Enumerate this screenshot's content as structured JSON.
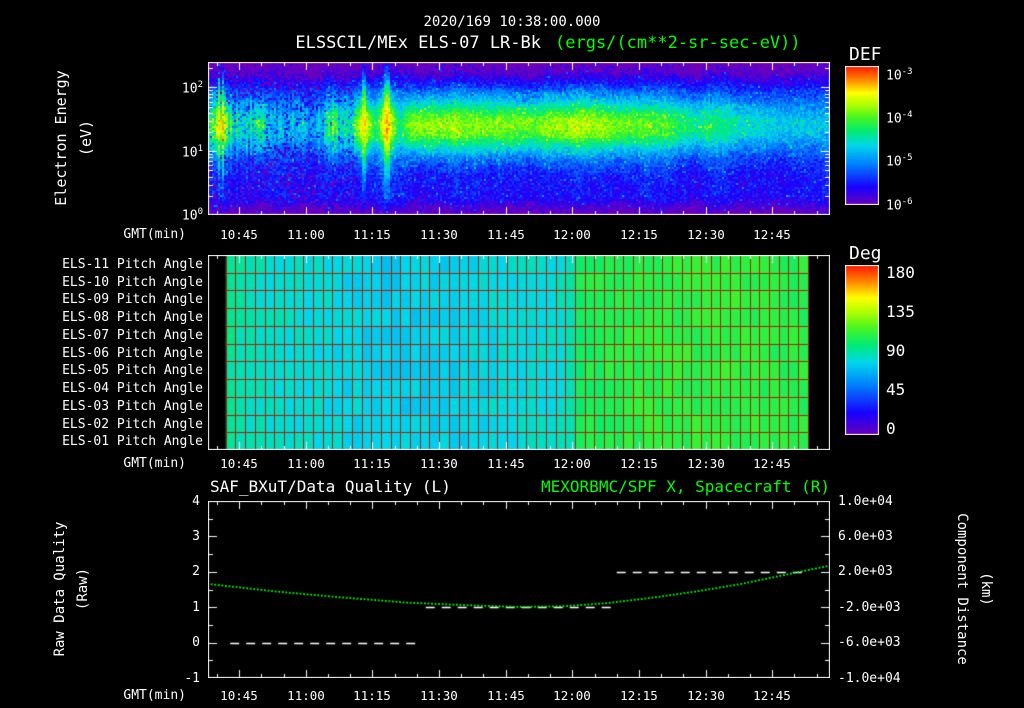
{
  "header": {
    "timestamp": "2020/169 10:38:00.000",
    "title": "ELSSCIL/MEx ELS-07 LR-Bk",
    "units": "(ergs/(cm**2-sr-sec-eV))"
  },
  "colors": {
    "background": "#000000",
    "foreground": "#ffffff",
    "accent": "#00ff00",
    "grid_red": "#aa2200"
  },
  "time_axis": {
    "label": "GMT(min)",
    "start_gmt": "10:38",
    "span_min": 140,
    "ticks": [
      "10:45",
      "11:00",
      "11:15",
      "11:30",
      "11:45",
      "12:00",
      "12:15",
      "12:30",
      "12:45"
    ]
  },
  "spectrogram": {
    "ylabel_1": "Electron Energy",
    "ylabel_2": "(eV)",
    "yticks": [
      {
        "base": "10",
        "exp": "2"
      },
      {
        "base": "10",
        "exp": "1"
      },
      {
        "base": "10",
        "exp": "0"
      }
    ],
    "colorbar": {
      "label": "DEF",
      "ticks": [
        {
          "base": "10",
          "exp": "-3"
        },
        {
          "base": "10",
          "exp": "-4"
        },
        {
          "base": "10",
          "exp": "-5"
        },
        {
          "base": "10",
          "exp": "-6"
        }
      ]
    }
  },
  "pitch_panel": {
    "rows": [
      "ELS-11 Pitch Angle",
      "ELS-10 Pitch Angle",
      "ELS-09 Pitch Angle",
      "ELS-08 Pitch Angle",
      "ELS-07 Pitch Angle",
      "ELS-06 Pitch Angle",
      "ELS-05 Pitch Angle",
      "ELS-04 Pitch Angle",
      "ELS-03 Pitch Angle",
      "ELS-02 Pitch Angle",
      "ELS-01 Pitch Angle"
    ],
    "colorbar": {
      "label": "Deg",
      "ticks": [
        "180",
        "135",
        "90",
        "45",
        "0"
      ]
    }
  },
  "line_panel": {
    "title_left": "SAF_BXuT/Data Quality (L)",
    "title_right": "MEXORBMC/SPF X, Spacecraft (R)",
    "ylabel_left_1": "Raw Data Quality",
    "ylabel_left_2": "(Raw)",
    "ylabel_right_1": "Component Distance",
    "ylabel_right_2": "(km)",
    "yticks_left": [
      "4",
      "3",
      "2",
      "1",
      "0",
      "-1"
    ],
    "yticks_right": [
      "1.0e+04",
      "6.0e+03",
      "2.0e+03",
      "-2.0e+03",
      "-6.0e+03",
      "-1.0e+04"
    ]
  },
  "chart_data": [
    {
      "type": "heatmap",
      "name": "electron-energy-spectrogram",
      "title": "ELSSCIL/MEx ELS-07 LR-Bk",
      "units": "ergs/(cm**2-sr-sec-eV)",
      "xlabel": "GMT(min)",
      "ylabel": "Electron Energy (eV)",
      "x_range_gmt": [
        "10:38",
        "12:58"
      ],
      "x_ticks": [
        "10:45",
        "11:00",
        "11:15",
        "11:30",
        "11:45",
        "12:00",
        "12:15",
        "12:30",
        "12:45"
      ],
      "y_scale": "log",
      "y_range_ev": [
        1,
        251
      ],
      "y_ticks_ev": [
        1,
        10,
        100
      ],
      "color_scale": {
        "label": "DEF",
        "scale": "log",
        "min": 1e-06,
        "max": 0.001,
        "ticks": [
          0.001,
          0.0001,
          1e-05,
          1e-06
        ]
      },
      "background_log10_flux": -5.55,
      "band": {
        "center_ev": 26,
        "extent_ev": [
          8,
          70
        ],
        "t_unit": "minutes after 10:38",
        "amplitude_by_time": [
          {
            "t": 0,
            "amp": 0.55
          },
          {
            "t": 3,
            "amp": 0.85
          },
          {
            "t": 7,
            "amp": 0.4
          },
          {
            "t": 11,
            "amp": 0.6
          },
          {
            "t": 15,
            "amp": 0.3
          },
          {
            "t": 20,
            "amp": 0.45
          },
          {
            "t": 24,
            "amp": 0.32
          },
          {
            "t": 28,
            "amp": 0.7
          },
          {
            "t": 31,
            "amp": 0.45
          },
          {
            "t": 35,
            "amp": 1.02
          },
          {
            "t": 37.5,
            "amp": 0.55
          },
          {
            "t": 40,
            "amp": 1.05
          },
          {
            "t": 43,
            "amp": 0.5
          },
          {
            "t": 46,
            "amp": 0.85
          },
          {
            "t": 60,
            "amp": 0.78
          },
          {
            "t": 75,
            "amp": 0.8
          },
          {
            "t": 85,
            "amp": 0.86
          },
          {
            "t": 95,
            "amp": 0.75
          },
          {
            "t": 105,
            "amp": 0.65
          },
          {
            "t": 120,
            "amp": 0.5
          },
          {
            "t": 140,
            "amp": 0.35
          }
        ]
      },
      "bright_events_gmt": [
        [
          "11:13",
          "11:17"
        ],
        [
          "11:18",
          "11:21"
        ]
      ]
    },
    {
      "type": "heatmap",
      "name": "pitch-angle-panel",
      "rows": [
        "ELS-11",
        "ELS-10",
        "ELS-09",
        "ELS-08",
        "ELS-07",
        "ELS-06",
        "ELS-05",
        "ELS-04",
        "ELS-03",
        "ELS-02",
        "ELS-01"
      ],
      "row_count": 11,
      "xlabel": "GMT(min)",
      "data_range_gmt": [
        "10:42",
        "12:53"
      ],
      "columns": 60,
      "value_unit": "deg",
      "color_scale": {
        "label": "Deg",
        "min": 0,
        "max": 180,
        "ticks": [
          180,
          135,
          90,
          45,
          0
        ]
      },
      "t_unit": "minutes after 10:38",
      "pitch_by_time": [
        {
          "t": 4,
          "deg": 92
        },
        {
          "t": 10,
          "deg": 84
        },
        {
          "t": 25,
          "deg": 80
        },
        {
          "t": 40,
          "deg": 75
        },
        {
          "t": 55,
          "deg": 76
        },
        {
          "t": 70,
          "deg": 80
        },
        {
          "t": 81,
          "deg": 83
        },
        {
          "t": 84,
          "deg": 101
        },
        {
          "t": 95,
          "deg": 105
        },
        {
          "t": 115,
          "deg": 107
        },
        {
          "t": 135,
          "deg": 104
        }
      ]
    },
    {
      "type": "line",
      "name": "data-quality-and-spacecraft-x",
      "title_left": "SAF_BXuT/Data Quality (L)",
      "title_right": "MEXORBMC/SPF X, Spacecraft (R)",
      "xlabel": "GMT(min)",
      "ylabel_left": "Raw Data Quality (Raw)",
      "ylabel_right": "Component Distance (km)",
      "ylim_left": [
        -1,
        4
      ],
      "ylim_right": [
        -10000,
        10000
      ],
      "series": [
        {
          "name": "SAF_BXuT Data Quality",
          "axis": "left",
          "color": "#ffffff",
          "style": "dashed",
          "segments": [
            {
              "value": 0,
              "gmt": [
                "10:43",
                "11:25"
              ]
            },
            {
              "value": 1,
              "gmt": [
                "11:27",
                "12:10"
              ]
            },
            {
              "value": 2,
              "gmt": [
                "12:10",
                "12:52"
              ]
            }
          ]
        },
        {
          "name": "MEXORBMC/SPF X Spacecraft",
          "axis": "right",
          "color": "#00ff00",
          "style": "dotted",
          "t_unit": "minutes after 10:38",
          "t_min": [
            0,
            15,
            30,
            45,
            60,
            70,
            80,
            90,
            100,
            110,
            120,
            130,
            140
          ],
          "values_left_axis": [
            1.66,
            1.45,
            1.28,
            1.13,
            1.05,
            1.01,
            1.03,
            1.12,
            1.27,
            1.45,
            1.66,
            1.92,
            2.18
          ],
          "values_right_km": [
            640,
            -200,
            -880,
            -1480,
            -1800,
            -1960,
            -1880,
            -1520,
            -920,
            -200,
            640,
            1680,
            2720
          ]
        }
      ]
    }
  ]
}
